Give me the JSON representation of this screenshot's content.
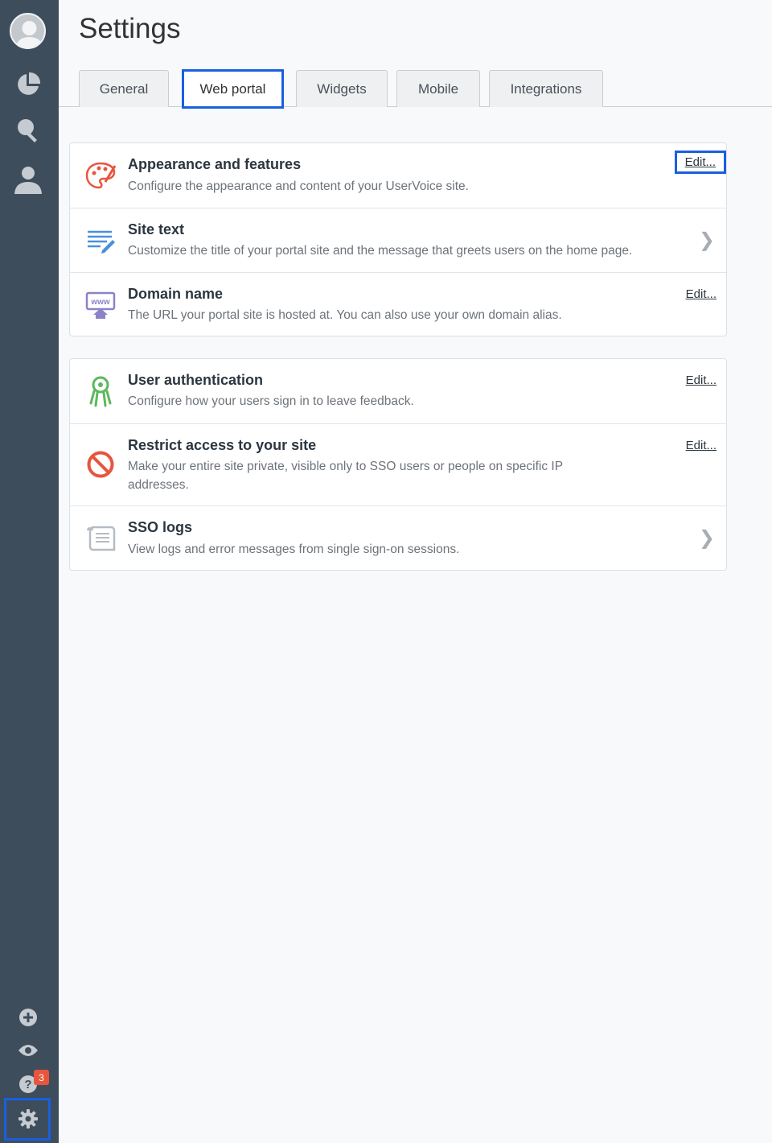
{
  "page": {
    "title": "Settings"
  },
  "tabs": [
    {
      "label": "General"
    },
    {
      "label": "Web portal",
      "active": true
    },
    {
      "label": "Widgets"
    },
    {
      "label": "Mobile"
    },
    {
      "label": "Integrations"
    }
  ],
  "sidebar": {
    "items": [
      {
        "icon": "user-avatar-icon"
      },
      {
        "icon": "pie-chart-icon"
      },
      {
        "icon": "lightbulb-icon"
      },
      {
        "icon": "person-icon"
      },
      {
        "icon": "plus-circle-icon"
      },
      {
        "icon": "eye-icon"
      },
      {
        "icon": "help-icon",
        "badge": "3"
      },
      {
        "icon": "gear-icon"
      }
    ]
  },
  "sections": [
    {
      "rows": [
        {
          "title": "Appearance and features",
          "desc": "Configure the appearance and content of your UserVoice site.",
          "action": "Edit...",
          "icon": "palette-icon"
        },
        {
          "title": "Site text",
          "desc": "Customize the title of your portal site and the message that greets users on the home page.",
          "action": "❯",
          "icon": "text-edit-icon"
        },
        {
          "title": "Domain name",
          "desc": "The URL your portal site is hosted at. You can also use your own domain alias.",
          "action": "Edit...",
          "icon": "www-home-icon"
        }
      ]
    },
    {
      "rows": [
        {
          "title": "User authentication",
          "desc": "Configure how your users sign in to leave feedback.",
          "action": "Edit...",
          "icon": "user-key-icon"
        },
        {
          "title": "Restrict access to your site",
          "desc": "Make your entire site private, visible only to SSO users or people on specific IP addresses.",
          "action": "Edit...",
          "icon": "no-entry-icon"
        },
        {
          "title": "SSO logs",
          "desc": "View logs and error messages from single sign-on sessions.",
          "action": "❯",
          "icon": "scroll-icon"
        }
      ]
    }
  ],
  "colors": {
    "sidebar": "#3e4d5c",
    "highlight": "#1a5fe0",
    "badge": "#e8553d"
  }
}
